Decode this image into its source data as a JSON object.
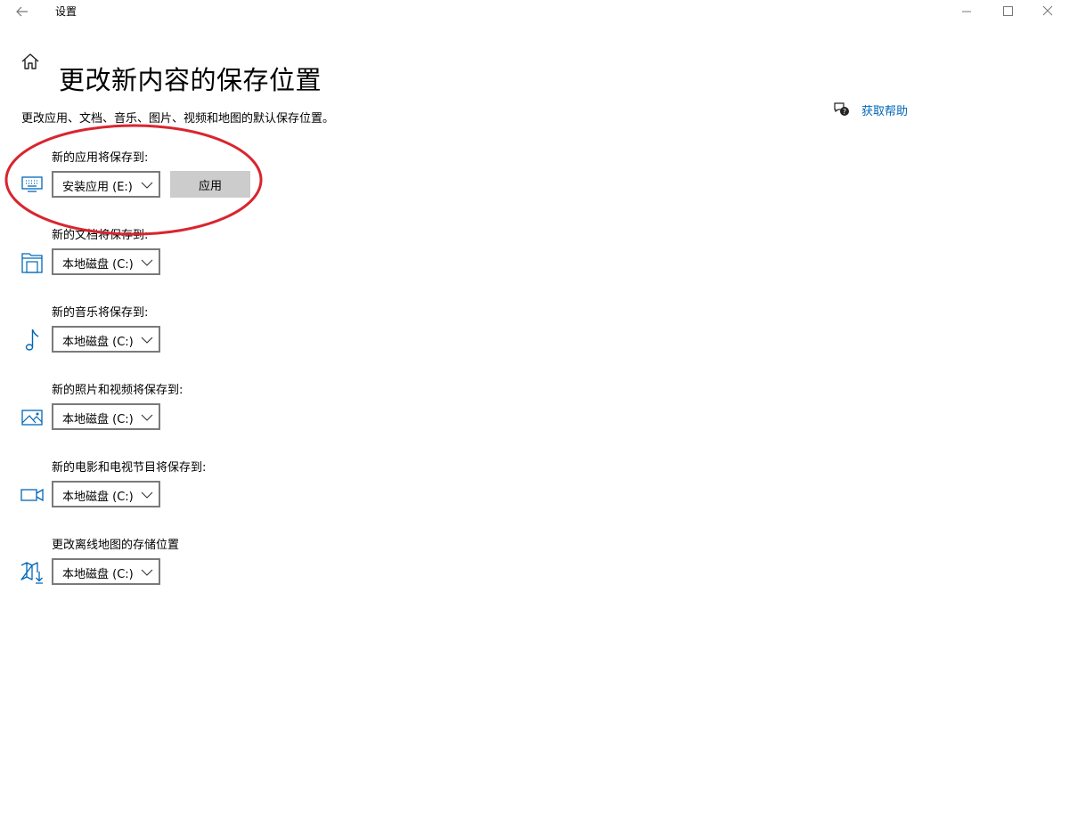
{
  "window": {
    "title": "设置"
  },
  "page": {
    "title": "更改新内容的保存位置",
    "description": "更改应用、文档、音乐、图片、视频和地图的默认保存位置。"
  },
  "help": {
    "label": "获取帮助",
    "icon": "chat-help-icon"
  },
  "accent_color": "#0067b8",
  "annotation_color": "#d9252f",
  "rows": [
    {
      "label": "新的应用将保存到:",
      "value": "安装应用 (E:)",
      "icon": "monitor-keyboard-icon",
      "button": "应用"
    },
    {
      "label": "新的文档将保存到:",
      "value": "本地磁盘 (C:)",
      "icon": "documents-icon"
    },
    {
      "label": "新的音乐将保存到:",
      "value": "本地磁盘 (C:)",
      "icon": "music-note-icon"
    },
    {
      "label": "新的照片和视频将保存到:",
      "value": "本地磁盘 (C:)",
      "icon": "picture-icon"
    },
    {
      "label": "新的电影和电视节目将保存到:",
      "value": "本地磁盘 (C:)",
      "icon": "video-camera-icon"
    },
    {
      "label": "更改离线地图的存储位置",
      "value": "本地磁盘 (C:)",
      "icon": "map-download-icon"
    }
  ]
}
